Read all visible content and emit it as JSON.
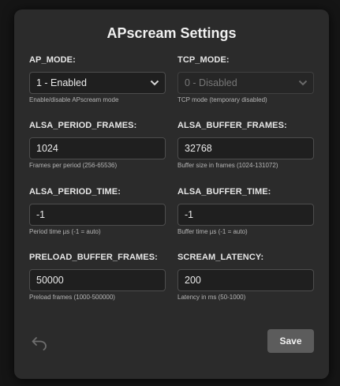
{
  "dialog": {
    "title": "APscream Settings",
    "save_label": "Save",
    "back_icon": "undo-arrow-icon"
  },
  "fields": {
    "ap_mode": {
      "label": "AP_MODE:",
      "value": "1 - Enabled",
      "help": "Enable/disable APscream mode"
    },
    "tcp_mode": {
      "label": "TCP_MODE:",
      "value": "0 - Disabled",
      "help": "TCP mode (temporary disabled)"
    },
    "alsa_period_frames": {
      "label": "ALSA_PERIOD_FRAMES:",
      "value": "1024",
      "help": "Frames per period (256-65536)"
    },
    "alsa_buffer_frames": {
      "label": "ALSA_BUFFER_FRAMES:",
      "value": "32768",
      "help": "Buffer size in frames (1024-131072)"
    },
    "alsa_period_time": {
      "label": "ALSA_PERIOD_TIME:",
      "value": "-1",
      "help": "Period time µs (-1 = auto)"
    },
    "alsa_buffer_time": {
      "label": "ALSA_BUFFER_TIME:",
      "value": "-1",
      "help": "Buffer time µs (-1 = auto)"
    },
    "preload_buffer_frames": {
      "label": "PRELOAD_BUFFER_FRAMES:",
      "value": "50000",
      "help": "Preload frames (1000-500000)"
    },
    "scream_latency": {
      "label": "SCREAM_LATENCY:",
      "value": "200",
      "help": "Latency in ms (50-1000)"
    }
  },
  "colors": {
    "dialog_bg": "#2b2b2b",
    "input_bg": "#1f1f1f",
    "save_button_bg": "#5c5c5c",
    "disabled_text": "#777777"
  }
}
